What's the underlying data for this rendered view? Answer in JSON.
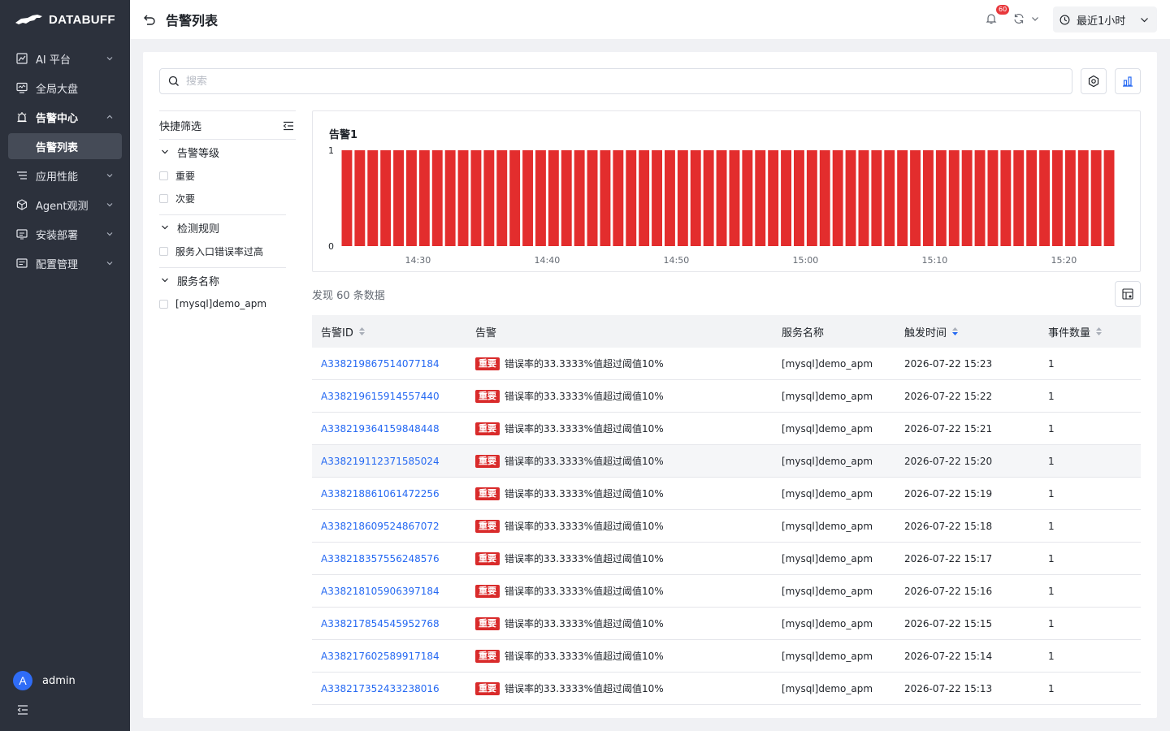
{
  "app": {
    "brand": "DATABUFF"
  },
  "sidebar": {
    "items": [
      {
        "label": "AI 平台",
        "icon": "ai-chart-icon",
        "chevron": "down"
      },
      {
        "label": "全局大盘",
        "icon": "dashboard-icon",
        "chevron": ""
      },
      {
        "label": "告警中心",
        "icon": "alarm-icon",
        "chevron": "up",
        "active": true
      },
      {
        "label": "应用性能",
        "icon": "apm-icon",
        "chevron": "down"
      },
      {
        "label": "Agent观测",
        "icon": "cube-icon",
        "chevron": "down"
      },
      {
        "label": "安装部署",
        "icon": "deploy-icon",
        "chevron": "down"
      },
      {
        "label": "配置管理",
        "icon": "config-icon",
        "chevron": "down"
      }
    ],
    "active_sub": "告警列表",
    "user": {
      "initial": "A",
      "name": "admin"
    }
  },
  "header": {
    "title": "告警列表",
    "notification_count": "60",
    "time_range": "最近1小时"
  },
  "search": {
    "placeholder": "搜索",
    "value": ""
  },
  "filter": {
    "title": "快捷筛选",
    "groups": [
      {
        "title": "告警等级",
        "options": [
          "重要",
          "次要"
        ]
      },
      {
        "title": "检测规则",
        "options": [
          "服务入口错误率过高"
        ]
      },
      {
        "title": "服务名称",
        "options": [
          "[mysql]demo_apm"
        ]
      }
    ]
  },
  "chart_data": {
    "type": "bar",
    "title": "告警1",
    "color": "#e32d2d",
    "ylim": [
      0,
      1
    ],
    "yticks": [
      "0",
      "1"
    ],
    "xticks": [
      "14:30",
      "14:40",
      "14:50",
      "15:00",
      "15:10",
      "15:20"
    ],
    "bar_count": 60,
    "values": [
      1,
      1,
      1,
      1,
      1,
      1,
      1,
      1,
      1,
      1,
      1,
      1,
      1,
      1,
      1,
      1,
      1,
      1,
      1,
      1,
      1,
      1,
      1,
      1,
      1,
      1,
      1,
      1,
      1,
      1,
      1,
      1,
      1,
      1,
      1,
      1,
      1,
      1,
      1,
      1,
      1,
      1,
      1,
      1,
      1,
      1,
      1,
      1,
      1,
      1,
      1,
      1,
      1,
      1,
      1,
      1,
      1,
      1,
      1,
      1
    ]
  },
  "results": {
    "found_text": "发现 60 条数据"
  },
  "table": {
    "columns": [
      "告警ID",
      "告警",
      "服务名称",
      "触发时间",
      "事件数量"
    ],
    "rows": [
      {
        "id": "A338219867514077184",
        "level": "重要",
        "alarm": "错误率的33.3333%值超过阈值10%",
        "service": "[mysql]demo_apm",
        "time": "2026-07-22 15:23",
        "count": "1"
      },
      {
        "id": "A338219615914557440",
        "level": "重要",
        "alarm": "错误率的33.3333%值超过阈值10%",
        "service": "[mysql]demo_apm",
        "time": "2026-07-22 15:22",
        "count": "1"
      },
      {
        "id": "A338219364159848448",
        "level": "重要",
        "alarm": "错误率的33.3333%值超过阈值10%",
        "service": "[mysql]demo_apm",
        "time": "2026-07-22 15:21",
        "count": "1"
      },
      {
        "id": "A338219112371585024",
        "level": "重要",
        "alarm": "错误率的33.3333%值超过阈值10%",
        "service": "[mysql]demo_apm",
        "time": "2026-07-22 15:20",
        "count": "1"
      },
      {
        "id": "A338218861061472256",
        "level": "重要",
        "alarm": "错误率的33.3333%值超过阈值10%",
        "service": "[mysql]demo_apm",
        "time": "2026-07-22 15:19",
        "count": "1"
      },
      {
        "id": "A338218609524867072",
        "level": "重要",
        "alarm": "错误率的33.3333%值超过阈值10%",
        "service": "[mysql]demo_apm",
        "time": "2026-07-22 15:18",
        "count": "1"
      },
      {
        "id": "A338218357556248576",
        "level": "重要",
        "alarm": "错误率的33.3333%值超过阈值10%",
        "service": "[mysql]demo_apm",
        "time": "2026-07-22 15:17",
        "count": "1"
      },
      {
        "id": "A338218105906397184",
        "level": "重要",
        "alarm": "错误率的33.3333%值超过阈值10%",
        "service": "[mysql]demo_apm",
        "time": "2026-07-22 15:16",
        "count": "1"
      },
      {
        "id": "A338217854545952768",
        "level": "重要",
        "alarm": "错误率的33.3333%值超过阈值10%",
        "service": "[mysql]demo_apm",
        "time": "2026-07-22 15:15",
        "count": "1"
      },
      {
        "id": "A338217602589917184",
        "level": "重要",
        "alarm": "错误率的33.3333%值超过阈值10%",
        "service": "[mysql]demo_apm",
        "time": "2026-07-22 15:14",
        "count": "1"
      },
      {
        "id": "A338217352433238016",
        "level": "重要",
        "alarm": "错误率的33.3333%值超过阈值10%",
        "service": "[mysql]demo_apm",
        "time": "2026-07-22 15:13",
        "count": "1"
      }
    ]
  }
}
